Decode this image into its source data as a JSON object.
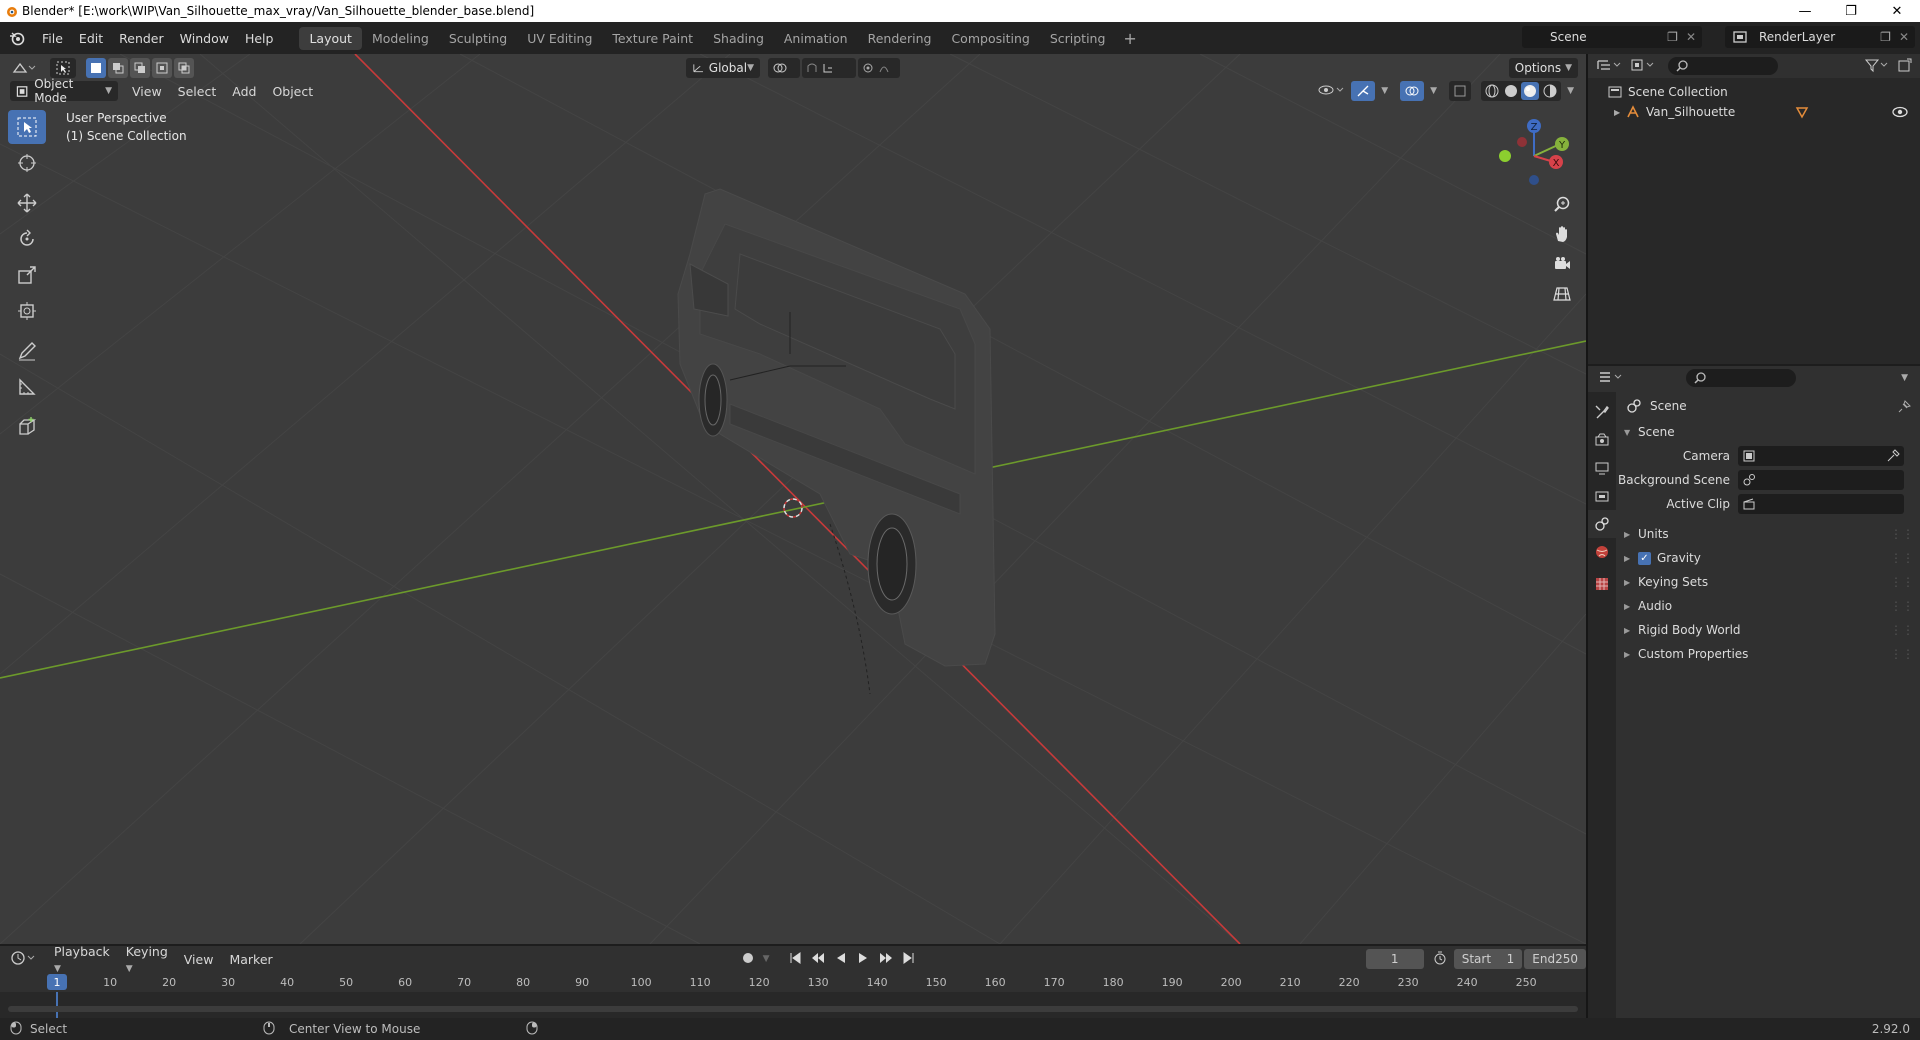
{
  "window": {
    "title": "Blender* [E:\\work\\WIP\\Van_Silhouette_max_vray/Van_Silhouette_blender_base.blend]",
    "controls": [
      "minimize",
      "restore",
      "close"
    ]
  },
  "menubar": {
    "items": [
      "File",
      "Edit",
      "Render",
      "Window",
      "Help"
    ],
    "workspaces": [
      "Layout",
      "Modeling",
      "Sculpting",
      "UV Editing",
      "Texture Paint",
      "Shading",
      "Animation",
      "Rendering",
      "Compositing",
      "Scripting"
    ],
    "active_workspace": "Layout",
    "scene": "Scene",
    "render_layer": "RenderLayer"
  },
  "viewport": {
    "transform_orientation": "Global",
    "options_label": "Options",
    "mode": "Object Mode",
    "menus": [
      "View",
      "Select",
      "Add",
      "Object"
    ],
    "perspective_label": "User Perspective",
    "collection_label": "(1) Scene Collection",
    "gizmo_axes": {
      "x": "X",
      "y": "Y",
      "z": "Z"
    },
    "colors": {
      "x_axis": "#c83a3a",
      "y_axis": "#6c9a2b",
      "grid": "#474747",
      "background": "#3c3c3c"
    }
  },
  "toolbar": {
    "tools": [
      "select-box",
      "cursor",
      "move",
      "rotate",
      "scale",
      "transform",
      "annotate",
      "measure",
      "add-cube"
    ],
    "active": "select-box"
  },
  "outliner": {
    "root": "Scene Collection",
    "items": [
      {
        "name": "Van_Silhouette",
        "visible": true
      }
    ]
  },
  "properties": {
    "context_title": "Scene",
    "section": "Scene",
    "fields": [
      {
        "label": "Camera",
        "value": ""
      },
      {
        "label": "Background Scene",
        "value": ""
      },
      {
        "label": "Active Clip",
        "value": ""
      }
    ],
    "panels": [
      {
        "label": "Units",
        "checkbox": false
      },
      {
        "label": "Gravity",
        "checkbox": true
      },
      {
        "label": "Keying Sets",
        "checkbox": false
      },
      {
        "label": "Audio",
        "checkbox": false
      },
      {
        "label": "Rigid Body World",
        "checkbox": false
      },
      {
        "label": "Custom Properties",
        "checkbox": false
      }
    ]
  },
  "timeline": {
    "menus": [
      "Playback",
      "Keying",
      "View",
      "Marker"
    ],
    "current_frame": "1",
    "start_label": "Start",
    "start": "1",
    "end_label": "End",
    "end": "250",
    "ticks": [
      "1",
      "10",
      "20",
      "30",
      "40",
      "50",
      "60",
      "70",
      "80",
      "90",
      "100",
      "110",
      "120",
      "130",
      "140",
      "150",
      "160",
      "170",
      "180",
      "190",
      "200",
      "210",
      "220",
      "230",
      "240",
      "250"
    ]
  },
  "statusbar": {
    "left_action": "Select",
    "middle_action": "Center View to Mouse",
    "version": "2.92.0"
  }
}
